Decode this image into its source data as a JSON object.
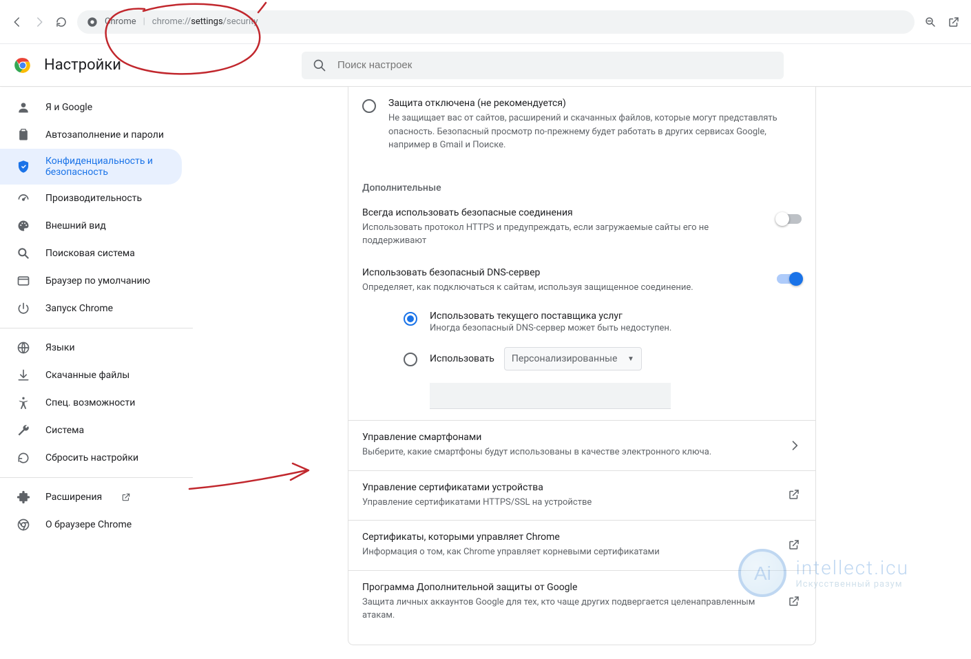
{
  "browser": {
    "label": "Chrome",
    "url_prefix": "chrome://",
    "url_mid": "settings",
    "url_suffix": "/security"
  },
  "header": {
    "title": "Настройки",
    "search_placeholder": "Поиск настроек"
  },
  "sidebar": {
    "items": [
      {
        "label": "Я и Google"
      },
      {
        "label": "Автозаполнение и пароли"
      },
      {
        "label": "Конфиденциальность и безопасность"
      },
      {
        "label": "Производительность"
      },
      {
        "label": "Внешний вид"
      },
      {
        "label": "Поисковая система"
      },
      {
        "label": "Браузер по умолчанию"
      },
      {
        "label": "Запуск Chrome"
      }
    ],
    "items2": [
      {
        "label": "Языки"
      },
      {
        "label": "Скачанные файлы"
      },
      {
        "label": "Спец. возможности"
      },
      {
        "label": "Система"
      },
      {
        "label": "Сбросить настройки"
      }
    ],
    "items3": [
      {
        "label": "Расширения"
      },
      {
        "label": "О браузере Chrome"
      }
    ]
  },
  "main": {
    "no_protection": {
      "title": "Защита отключена (не рекомендуется)",
      "desc": "Не защищает вас от сайтов, расширений и скачанных файлов, которые могут представлять опасность. Безопасный просмотр по-прежнему будет работать в других сервисах Google, например в Gmail и Поиске."
    },
    "advanced_label": "Дополнительные",
    "https": {
      "title": "Всегда использовать безопасные соединения",
      "desc": "Использовать протокол HTTPS и предупреждать, если загружаемые сайты его не поддерживают"
    },
    "dns": {
      "title": "Использовать безопасный DNS-сервер",
      "desc": "Определяет, как подключаться к сайтам, используя защищенное соединение.",
      "opt1_title": "Использовать текущего поставщика услуг",
      "opt1_desc": "Иногда безопасный DNS-сервер может быть недоступен.",
      "opt2_label": "Использовать",
      "opt2_dropdown": "Персонализированные"
    },
    "phones": {
      "title": "Управление смартфонами",
      "desc": "Выберите, какие смартфоны будут использованы в качестве электронного ключа."
    },
    "certs_device": {
      "title": "Управление сертификатами устройства",
      "desc": "Управление сертификатами HTTPS/SSL на устройстве"
    },
    "certs_chrome": {
      "title": "Сертификаты, которыми управляет Chrome",
      "desc": "Информация о том, как Chrome управляет корневыми сертификатами"
    },
    "advanced_protection": {
      "title": "Программа Дополнительной защиты от Google",
      "desc": "Защита личных аккаунтов Google для тех, кто чаще других подвергается целенаправленным атакам."
    }
  },
  "watermark": {
    "line1": "intellect.icu",
    "line2": "Искусственный разум"
  }
}
